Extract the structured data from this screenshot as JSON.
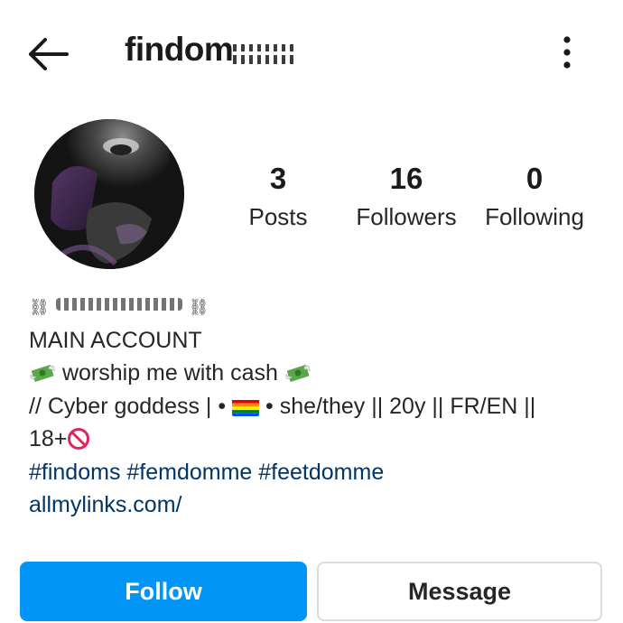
{
  "header": {
    "username_visible": "findom",
    "back_icon": "arrow-left-icon",
    "more_icon": "more-vertical-icon"
  },
  "profile": {
    "avatar_icon": "profile-avatar",
    "stats": [
      {
        "value": "3",
        "label": "Posts"
      },
      {
        "value": "16",
        "label": "Followers"
      },
      {
        "value": "0",
        "label": "Following"
      }
    ]
  },
  "bio": {
    "name_prefix": "⛓",
    "name_suffix": "⛓",
    "line1": "MAIN ACCOUNT",
    "line2": "worship me with cash",
    "line3_a": "// Cyber goddess |  •",
    "line3_b": "• she/they || 20y || FR/EN ||",
    "line4": "18+",
    "hashtags": "#findoms #femdomme #feetdomme",
    "link": "allmylinks.com/"
  },
  "actions": {
    "follow_label": "Follow",
    "message_label": "Message"
  },
  "colors": {
    "accent": "#0095f6",
    "link": "#003569",
    "text": "#262626"
  }
}
